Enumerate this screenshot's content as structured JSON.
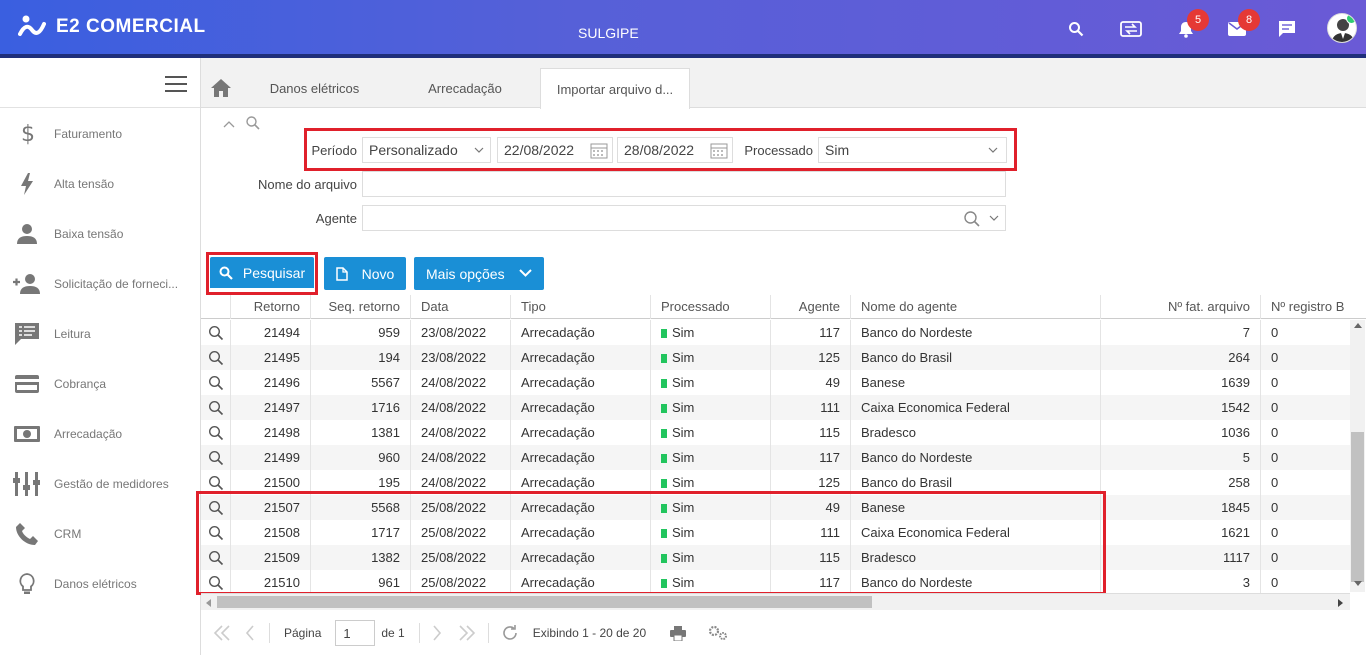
{
  "app": {
    "brand": "E2 COMERCIAL",
    "company": "SULGIPE"
  },
  "topbar": {
    "notifications_count": "5",
    "messages_count": "8"
  },
  "sidebar": {
    "items": [
      {
        "label": "Faturamento",
        "icon": "dollar-icon"
      },
      {
        "label": "Alta tensão",
        "icon": "lightning-icon"
      },
      {
        "label": "Baixa tensão",
        "icon": "person-icon"
      },
      {
        "label": "Solicitação de forneci...",
        "icon": "add-person-icon"
      },
      {
        "label": "Leitura",
        "icon": "reading-icon"
      },
      {
        "label": "Cobrança",
        "icon": "card-icon"
      },
      {
        "label": "Arrecadação",
        "icon": "money-icon"
      },
      {
        "label": "Gestão de medidores",
        "icon": "meters-icon"
      },
      {
        "label": "CRM",
        "icon": "phone-icon"
      },
      {
        "label": "Danos elétricos",
        "icon": "bulb-icon"
      }
    ]
  },
  "tabs": [
    {
      "label": "Danos elétricos"
    },
    {
      "label": "Arrecadação"
    },
    {
      "label": "Importar arquivo d..."
    }
  ],
  "filters": {
    "periodo_label": "Período",
    "periodo_value": "Personalizado",
    "date_from": "22/08/2022",
    "date_to": "28/08/2022",
    "processado_label": "Processado",
    "processado_value": "Sim",
    "nome_arquivo_label": "Nome do arquivo",
    "nome_arquivo_value": "",
    "agente_label": "Agente",
    "agente_value": ""
  },
  "actions": {
    "search": "Pesquisar",
    "new": "Novo",
    "more": "Mais opções"
  },
  "table": {
    "columns": [
      "Retorno",
      "Seq. retorno",
      "Data",
      "Tipo",
      "Processado",
      "Agente",
      "Nome do agente",
      "Nº fat. arquivo",
      "Nº registro B"
    ],
    "rows": [
      [
        "21494",
        "959",
        "23/08/2022",
        "Arrecadação",
        "Sim",
        "117",
        "Banco do Nordeste",
        "7",
        "0"
      ],
      [
        "21495",
        "194",
        "23/08/2022",
        "Arrecadação",
        "Sim",
        "125",
        "Banco do Brasil",
        "264",
        "0"
      ],
      [
        "21496",
        "5567",
        "24/08/2022",
        "Arrecadação",
        "Sim",
        "49",
        "Banese",
        "1639",
        "0"
      ],
      [
        "21497",
        "1716",
        "24/08/2022",
        "Arrecadação",
        "Sim",
        "111",
        "Caixa Economica Federal",
        "1542",
        "0"
      ],
      [
        "21498",
        "1381",
        "24/08/2022",
        "Arrecadação",
        "Sim",
        "115",
        "Bradesco",
        "1036",
        "0"
      ],
      [
        "21499",
        "960",
        "24/08/2022",
        "Arrecadação",
        "Sim",
        "117",
        "Banco do Nordeste",
        "5",
        "0"
      ],
      [
        "21500",
        "195",
        "24/08/2022",
        "Arrecadação",
        "Sim",
        "125",
        "Banco do Brasil",
        "258",
        "0"
      ],
      [
        "21507",
        "5568",
        "25/08/2022",
        "Arrecadação",
        "Sim",
        "49",
        "Banese",
        "1845",
        "0"
      ],
      [
        "21508",
        "1717",
        "25/08/2022",
        "Arrecadação",
        "Sim",
        "111",
        "Caixa Economica Federal",
        "1621",
        "0"
      ],
      [
        "21509",
        "1382",
        "25/08/2022",
        "Arrecadação",
        "Sim",
        "115",
        "Bradesco",
        "1117",
        "0"
      ],
      [
        "21510",
        "961",
        "25/08/2022",
        "Arrecadação",
        "Sim",
        "117",
        "Banco do Nordeste",
        "3",
        "0"
      ]
    ]
  },
  "pager": {
    "page_label": "Página",
    "page_value": "1",
    "of_label": "de 1",
    "showing": "Exibindo 1 - 20 de 20"
  },
  "colors": {
    "accent": "#1a8fd6",
    "highlight": "#e0202b",
    "status_green": "#22c55e"
  }
}
